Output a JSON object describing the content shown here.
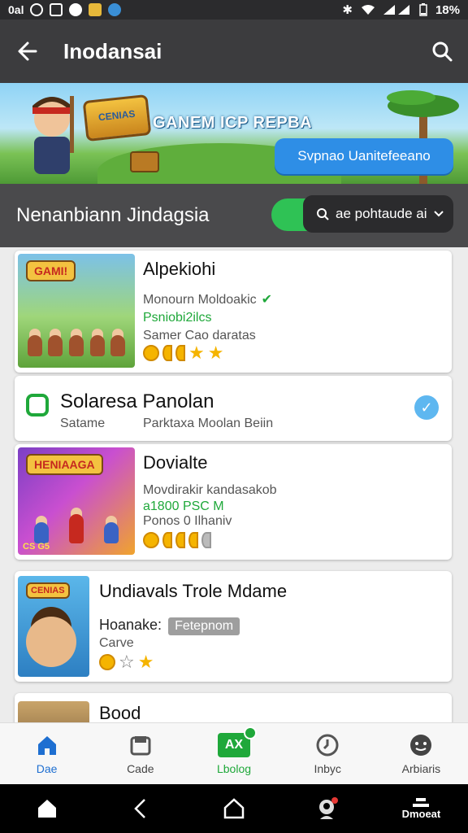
{
  "status_bar": {
    "left_text": "0al",
    "battery": "18%"
  },
  "app_bar": {
    "title": "Inodansai"
  },
  "banner": {
    "logo_text": "CENIAS",
    "title": "GANEM ICP REPBA",
    "cta_label": "Svpnao Uanitefeeano"
  },
  "section": {
    "title": "Nenanbiann Jindagsia",
    "filter_label": "ae pohtaude ai"
  },
  "cards": [
    {
      "title": "Alpekiohi",
      "badge": "GAMI!",
      "line1": "Monourn Moldoakic",
      "line2": "Psniobi2ilcs",
      "line3": "Samer Cao daratas"
    },
    {
      "title": "Solaresa Panolan",
      "sub1": "Satame",
      "sub2": "Parktaxa Moolan Beiin"
    },
    {
      "title": "Dovialte",
      "badge": "HENIAAGA",
      "line1": "Movdirakir kandasakob",
      "line2": "a1800 PSC M",
      "line3": "Ponos 0 Ilhaniv",
      "corner": "CS G5"
    },
    {
      "title": "Undiavals Trole Mdame",
      "badge": "CENIAS",
      "line1": "Hoanake:",
      "tag": "Fetepnom",
      "line2": "Carve"
    },
    {
      "title": "Bood"
    }
  ],
  "bottom_nav": [
    {
      "label": "Dae",
      "icon": "home-icon"
    },
    {
      "label": "Cade",
      "icon": "card-icon"
    },
    {
      "label": "Lbolog",
      "icon": "ax-icon",
      "icon_text": "AX"
    },
    {
      "label": "Inbyc",
      "icon": "clock-icon"
    },
    {
      "label": "Arbiaris",
      "icon": "face-icon"
    }
  ],
  "system_nav": {
    "right_label": "Dmoeat"
  },
  "colors": {
    "accent_green": "#1fa83a",
    "accent_blue": "#1e6fd1",
    "appbar": "#3c3c3e"
  }
}
